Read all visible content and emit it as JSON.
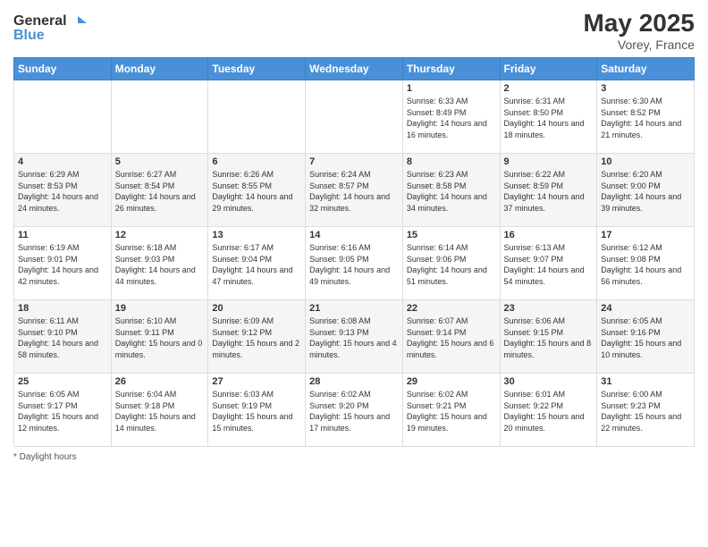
{
  "header": {
    "logo_general": "General",
    "logo_blue": "Blue",
    "month_year": "May 2025",
    "location": "Vorey, France"
  },
  "days_of_week": [
    "Sunday",
    "Monday",
    "Tuesday",
    "Wednesday",
    "Thursday",
    "Friday",
    "Saturday"
  ],
  "weeks": [
    [
      {
        "day": "",
        "info": ""
      },
      {
        "day": "",
        "info": ""
      },
      {
        "day": "",
        "info": ""
      },
      {
        "day": "",
        "info": ""
      },
      {
        "day": "1",
        "info": "Sunrise: 6:33 AM\nSunset: 8:49 PM\nDaylight: 14 hours and 16 minutes."
      },
      {
        "day": "2",
        "info": "Sunrise: 6:31 AM\nSunset: 8:50 PM\nDaylight: 14 hours and 18 minutes."
      },
      {
        "day": "3",
        "info": "Sunrise: 6:30 AM\nSunset: 8:52 PM\nDaylight: 14 hours and 21 minutes."
      }
    ],
    [
      {
        "day": "4",
        "info": "Sunrise: 6:29 AM\nSunset: 8:53 PM\nDaylight: 14 hours and 24 minutes."
      },
      {
        "day": "5",
        "info": "Sunrise: 6:27 AM\nSunset: 8:54 PM\nDaylight: 14 hours and 26 minutes."
      },
      {
        "day": "6",
        "info": "Sunrise: 6:26 AM\nSunset: 8:55 PM\nDaylight: 14 hours and 29 minutes."
      },
      {
        "day": "7",
        "info": "Sunrise: 6:24 AM\nSunset: 8:57 PM\nDaylight: 14 hours and 32 minutes."
      },
      {
        "day": "8",
        "info": "Sunrise: 6:23 AM\nSunset: 8:58 PM\nDaylight: 14 hours and 34 minutes."
      },
      {
        "day": "9",
        "info": "Sunrise: 6:22 AM\nSunset: 8:59 PM\nDaylight: 14 hours and 37 minutes."
      },
      {
        "day": "10",
        "info": "Sunrise: 6:20 AM\nSunset: 9:00 PM\nDaylight: 14 hours and 39 minutes."
      }
    ],
    [
      {
        "day": "11",
        "info": "Sunrise: 6:19 AM\nSunset: 9:01 PM\nDaylight: 14 hours and 42 minutes."
      },
      {
        "day": "12",
        "info": "Sunrise: 6:18 AM\nSunset: 9:03 PM\nDaylight: 14 hours and 44 minutes."
      },
      {
        "day": "13",
        "info": "Sunrise: 6:17 AM\nSunset: 9:04 PM\nDaylight: 14 hours and 47 minutes."
      },
      {
        "day": "14",
        "info": "Sunrise: 6:16 AM\nSunset: 9:05 PM\nDaylight: 14 hours and 49 minutes."
      },
      {
        "day": "15",
        "info": "Sunrise: 6:14 AM\nSunset: 9:06 PM\nDaylight: 14 hours and 51 minutes."
      },
      {
        "day": "16",
        "info": "Sunrise: 6:13 AM\nSunset: 9:07 PM\nDaylight: 14 hours and 54 minutes."
      },
      {
        "day": "17",
        "info": "Sunrise: 6:12 AM\nSunset: 9:08 PM\nDaylight: 14 hours and 56 minutes."
      }
    ],
    [
      {
        "day": "18",
        "info": "Sunrise: 6:11 AM\nSunset: 9:10 PM\nDaylight: 14 hours and 58 minutes."
      },
      {
        "day": "19",
        "info": "Sunrise: 6:10 AM\nSunset: 9:11 PM\nDaylight: 15 hours and 0 minutes."
      },
      {
        "day": "20",
        "info": "Sunrise: 6:09 AM\nSunset: 9:12 PM\nDaylight: 15 hours and 2 minutes."
      },
      {
        "day": "21",
        "info": "Sunrise: 6:08 AM\nSunset: 9:13 PM\nDaylight: 15 hours and 4 minutes."
      },
      {
        "day": "22",
        "info": "Sunrise: 6:07 AM\nSunset: 9:14 PM\nDaylight: 15 hours and 6 minutes."
      },
      {
        "day": "23",
        "info": "Sunrise: 6:06 AM\nSunset: 9:15 PM\nDaylight: 15 hours and 8 minutes."
      },
      {
        "day": "24",
        "info": "Sunrise: 6:05 AM\nSunset: 9:16 PM\nDaylight: 15 hours and 10 minutes."
      }
    ],
    [
      {
        "day": "25",
        "info": "Sunrise: 6:05 AM\nSunset: 9:17 PM\nDaylight: 15 hours and 12 minutes."
      },
      {
        "day": "26",
        "info": "Sunrise: 6:04 AM\nSunset: 9:18 PM\nDaylight: 15 hours and 14 minutes."
      },
      {
        "day": "27",
        "info": "Sunrise: 6:03 AM\nSunset: 9:19 PM\nDaylight: 15 hours and 15 minutes."
      },
      {
        "day": "28",
        "info": "Sunrise: 6:02 AM\nSunset: 9:20 PM\nDaylight: 15 hours and 17 minutes."
      },
      {
        "day": "29",
        "info": "Sunrise: 6:02 AM\nSunset: 9:21 PM\nDaylight: 15 hours and 19 minutes."
      },
      {
        "day": "30",
        "info": "Sunrise: 6:01 AM\nSunset: 9:22 PM\nDaylight: 15 hours and 20 minutes."
      },
      {
        "day": "31",
        "info": "Sunrise: 6:00 AM\nSunset: 9:23 PM\nDaylight: 15 hours and 22 minutes."
      }
    ]
  ],
  "footer": {
    "daylight_label": "Daylight hours"
  }
}
